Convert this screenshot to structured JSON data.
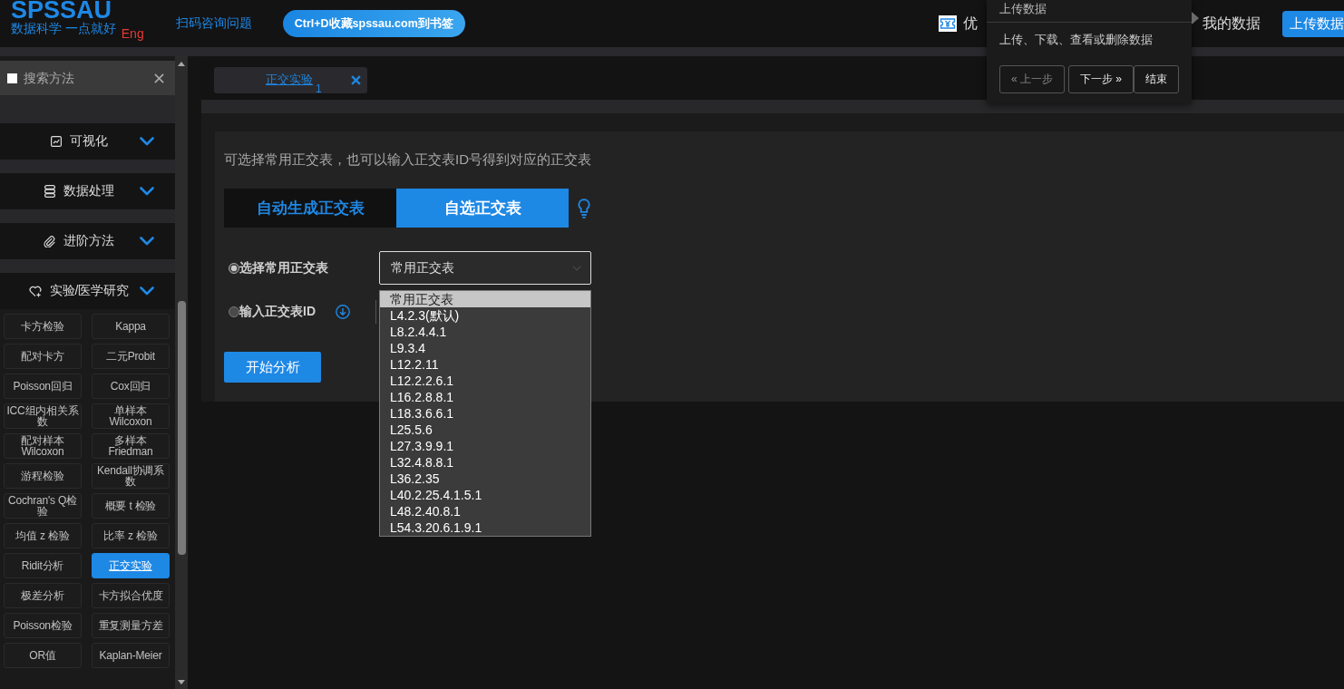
{
  "header": {
    "logo": "SPSSAU",
    "slogan": "数据科学 一点就好",
    "language": "Eng",
    "consult_link": "扫码咨询问题",
    "bookmark_button": "Ctrl+D收藏spssau.com到书签",
    "coupon": "优",
    "my_data": "我的数据",
    "upload_button": "上传数据"
  },
  "guide_popover": {
    "title": "上传数据",
    "text": "上传、下载、查看或删除数据",
    "buttons": [
      {
        "label": "« 上一步",
        "disabled": true
      },
      {
        "label": "下一步 »",
        "disabled": false
      },
      {
        "label": "结束",
        "disabled": false
      }
    ]
  },
  "sidebar": {
    "search": {
      "placeholder": "搜索方法"
    },
    "categories": [
      {
        "label": "可视化"
      },
      {
        "label": "数据处理"
      },
      {
        "label": "进阶方法"
      },
      {
        "label": "实验/医学研究"
      }
    ],
    "methods": [
      {
        "label": "卡方检验",
        "selected": false
      },
      {
        "label": "Kappa",
        "selected": false
      },
      {
        "label": "配对卡方",
        "selected": false
      },
      {
        "label": "二元Probit",
        "selected": false
      },
      {
        "label": "Poisson回归",
        "selected": false
      },
      {
        "label": "Cox回归",
        "selected": false
      },
      {
        "label": "ICC组内相关系数",
        "selected": false
      },
      {
        "label": "单样本Wilcoxon",
        "selected": false
      },
      {
        "label": "配对样本Wilcoxon",
        "selected": false
      },
      {
        "label": "多样本Friedman",
        "selected": false
      },
      {
        "label": "游程检验",
        "selected": false
      },
      {
        "label": "Kendall协调系数",
        "selected": false
      },
      {
        "label": "Cochran's Q检验",
        "selected": false
      },
      {
        "label": "概要 t 检验",
        "selected": false
      },
      {
        "label": "均值 z 检验",
        "selected": false
      },
      {
        "label": "比率 z 检验",
        "selected": false
      },
      {
        "label": "Ridit分析",
        "selected": false
      },
      {
        "label": "正交实验",
        "selected": true
      },
      {
        "label": "极差分析",
        "selected": false
      },
      {
        "label": "卡方拟合优度",
        "selected": false
      },
      {
        "label": "Poisson检验",
        "selected": false
      },
      {
        "label": "重复测量方差",
        "selected": false
      },
      {
        "label": "OR值",
        "selected": false
      },
      {
        "label": "Kaplan-Meier",
        "selected": false
      }
    ]
  },
  "tabs": [
    {
      "label": "正交实验",
      "badge": "1",
      "selected": true
    }
  ],
  "panel": {
    "intro": "可选择常用正交表，也可以输入正交表ID号得到对应的正交表",
    "modes": [
      {
        "label": "自动生成正交表",
        "selected": false
      },
      {
        "label": "自选正交表",
        "selected": true
      }
    ],
    "sources": [
      {
        "kind": "select",
        "label": "选择常用正交表",
        "selected": true,
        "select": {
          "value": "常用正交表",
          "expanded": true,
          "options": [
            {
              "label": "常用正交表",
              "selected": true
            },
            {
              "label": "L4.2.3(默认)",
              "selected": false
            },
            {
              "label": "L8.2.4.4.1",
              "selected": false
            },
            {
              "label": "L9.3.4",
              "selected": false
            },
            {
              "label": "L12.2.11",
              "selected": false
            },
            {
              "label": "L12.2.2.6.1",
              "selected": false
            },
            {
              "label": "L16.2.8.8.1",
              "selected": false
            },
            {
              "label": "L18.3.6.6.1",
              "selected": false
            },
            {
              "label": "L25.5.6",
              "selected": false
            },
            {
              "label": "L27.3.9.9.1",
              "selected": false
            },
            {
              "label": "L32.4.8.8.1",
              "selected": false
            },
            {
              "label": "L36.2.35",
              "selected": false
            },
            {
              "label": "L40.2.25.4.1.5.1",
              "selected": false
            },
            {
              "label": "L48.2.40.8.1",
              "selected": false
            },
            {
              "label": "L54.3.20.6.1.9.1",
              "selected": false
            }
          ]
        }
      },
      {
        "kind": "id_input",
        "label": "输入正交表ID",
        "selected": false
      }
    ],
    "submit_button": "开始分析"
  }
}
